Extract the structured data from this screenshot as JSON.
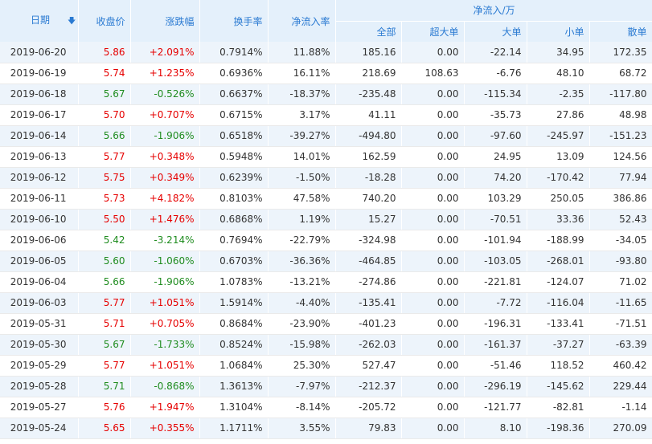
{
  "headers": {
    "date": "日期",
    "close": "收盘价",
    "change": "涨跌幅",
    "turnover": "换手率",
    "net_ratio": "净流入率",
    "net_group": "净流入/万",
    "sub": [
      "全部",
      "超大单",
      "大单",
      "小单",
      "散单"
    ]
  },
  "icons": {
    "sort": "sort-down-arrow-icon"
  },
  "colors": {
    "up": "#e60000",
    "down": "#1f8c1f",
    "header_bg": "#e4f0fb",
    "header_text": "#2a7ad2",
    "stripe": "#edf4fb"
  },
  "rows": [
    {
      "date": "2019-06-20",
      "close": "5.86",
      "change": "+2.091%",
      "dir": "up",
      "turnover": "0.7914%",
      "net_ratio": "11.88%",
      "all": "185.16",
      "super": "0.00",
      "large": "-22.14",
      "small": "34.95",
      "retail": "172.35"
    },
    {
      "date": "2019-06-19",
      "close": "5.74",
      "change": "+1.235%",
      "dir": "up",
      "turnover": "0.6936%",
      "net_ratio": "16.11%",
      "all": "218.69",
      "super": "108.63",
      "large": "-6.76",
      "small": "48.10",
      "retail": "68.72"
    },
    {
      "date": "2019-06-18",
      "close": "5.67",
      "change": "-0.526%",
      "dir": "down",
      "turnover": "0.6637%",
      "net_ratio": "-18.37%",
      "all": "-235.48",
      "super": "0.00",
      "large": "-115.34",
      "small": "-2.35",
      "retail": "-117.80"
    },
    {
      "date": "2019-06-17",
      "close": "5.70",
      "change": "+0.707%",
      "dir": "up",
      "turnover": "0.6715%",
      "net_ratio": "3.17%",
      "all": "41.11",
      "super": "0.00",
      "large": "-35.73",
      "small": "27.86",
      "retail": "48.98"
    },
    {
      "date": "2019-06-14",
      "close": "5.66",
      "change": "-1.906%",
      "dir": "down",
      "turnover": "0.6518%",
      "net_ratio": "-39.27%",
      "all": "-494.80",
      "super": "0.00",
      "large": "-97.60",
      "small": "-245.97",
      "retail": "-151.23"
    },
    {
      "date": "2019-06-13",
      "close": "5.77",
      "change": "+0.348%",
      "dir": "up",
      "turnover": "0.5948%",
      "net_ratio": "14.01%",
      "all": "162.59",
      "super": "0.00",
      "large": "24.95",
      "small": "13.09",
      "retail": "124.56"
    },
    {
      "date": "2019-06-12",
      "close": "5.75",
      "change": "+0.349%",
      "dir": "up",
      "turnover": "0.6239%",
      "net_ratio": "-1.50%",
      "all": "-18.28",
      "super": "0.00",
      "large": "74.20",
      "small": "-170.42",
      "retail": "77.94"
    },
    {
      "date": "2019-06-11",
      "close": "5.73",
      "change": "+4.182%",
      "dir": "up",
      "turnover": "0.8103%",
      "net_ratio": "47.58%",
      "all": "740.20",
      "super": "0.00",
      "large": "103.29",
      "small": "250.05",
      "retail": "386.86"
    },
    {
      "date": "2019-06-10",
      "close": "5.50",
      "change": "+1.476%",
      "dir": "up",
      "turnover": "0.6868%",
      "net_ratio": "1.19%",
      "all": "15.27",
      "super": "0.00",
      "large": "-70.51",
      "small": "33.36",
      "retail": "52.43"
    },
    {
      "date": "2019-06-06",
      "close": "5.42",
      "change": "-3.214%",
      "dir": "down",
      "turnover": "0.7694%",
      "net_ratio": "-22.79%",
      "all": "-324.98",
      "super": "0.00",
      "large": "-101.94",
      "small": "-188.99",
      "retail": "-34.05"
    },
    {
      "date": "2019-06-05",
      "close": "5.60",
      "change": "-1.060%",
      "dir": "down",
      "turnover": "0.6703%",
      "net_ratio": "-36.36%",
      "all": "-464.85",
      "super": "0.00",
      "large": "-103.05",
      "small": "-268.01",
      "retail": "-93.80"
    },
    {
      "date": "2019-06-04",
      "close": "5.66",
      "change": "-1.906%",
      "dir": "down",
      "turnover": "1.0783%",
      "net_ratio": "-13.21%",
      "all": "-274.86",
      "super": "0.00",
      "large": "-221.81",
      "small": "-124.07",
      "retail": "71.02"
    },
    {
      "date": "2019-06-03",
      "close": "5.77",
      "change": "+1.051%",
      "dir": "up",
      "turnover": "1.5914%",
      "net_ratio": "-4.40%",
      "all": "-135.41",
      "super": "0.00",
      "large": "-7.72",
      "small": "-116.04",
      "retail": "-11.65"
    },
    {
      "date": "2019-05-31",
      "close": "5.71",
      "change": "+0.705%",
      "dir": "up",
      "turnover": "0.8684%",
      "net_ratio": "-23.90%",
      "all": "-401.23",
      "super": "0.00",
      "large": "-196.31",
      "small": "-133.41",
      "retail": "-71.51"
    },
    {
      "date": "2019-05-30",
      "close": "5.67",
      "change": "-1.733%",
      "dir": "down",
      "turnover": "0.8524%",
      "net_ratio": "-15.98%",
      "all": "-262.03",
      "super": "0.00",
      "large": "-161.37",
      "small": "-37.27",
      "retail": "-63.39"
    },
    {
      "date": "2019-05-29",
      "close": "5.77",
      "change": "+1.051%",
      "dir": "up",
      "turnover": "1.0684%",
      "net_ratio": "25.30%",
      "all": "527.47",
      "super": "0.00",
      "large": "-51.46",
      "small": "118.52",
      "retail": "460.42"
    },
    {
      "date": "2019-05-28",
      "close": "5.71",
      "change": "-0.868%",
      "dir": "down",
      "turnover": "1.3613%",
      "net_ratio": "-7.97%",
      "all": "-212.37",
      "super": "0.00",
      "large": "-296.19",
      "small": "-145.62",
      "retail": "229.44"
    },
    {
      "date": "2019-05-27",
      "close": "5.76",
      "change": "+1.947%",
      "dir": "up",
      "turnover": "1.3104%",
      "net_ratio": "-8.14%",
      "all": "-205.72",
      "super": "0.00",
      "large": "-121.77",
      "small": "-82.81",
      "retail": "-1.14"
    },
    {
      "date": "2019-05-24",
      "close": "5.65",
      "change": "+0.355%",
      "dir": "up",
      "turnover": "1.1711%",
      "net_ratio": "3.55%",
      "all": "79.83",
      "super": "0.00",
      "large": "8.10",
      "small": "-198.36",
      "retail": "270.09"
    }
  ]
}
